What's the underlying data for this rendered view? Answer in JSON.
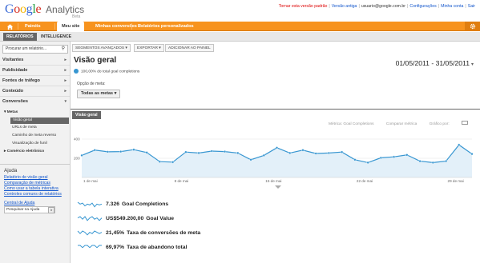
{
  "header": {
    "logo_google": "Google",
    "logo_analytics": "Analytics",
    "logo_beta": "Beta",
    "links": {
      "old_version": "Tornar esta versão padrão",
      "old_version_alt": "Versão antiga",
      "email": "usuario@google.com.br",
      "settings": "Configurações",
      "account": "Minha conta",
      "logout": "Sair"
    }
  },
  "nav": {
    "home_icon": "home-icon",
    "painel": "Painéis",
    "meu_site": "Meu site",
    "minhas_conversoes": "Minhas conversões",
    "relatorios": "Relatórios personalizados",
    "settings_icon": "gear-icon"
  },
  "subnav": {
    "relatorios": "RELATÓRIOS",
    "intelligence": "INTELLIGENCE"
  },
  "sidebar": {
    "search_placeholder": "Procurar um relatório...",
    "sections": [
      "Visitantes",
      "Publicidade",
      "Fontes de tráfego",
      "Conteúdo",
      "Conversões"
    ],
    "metas_label": "▾ Metas",
    "metas_items": [
      "Visão geral",
      "URLs de meta",
      "Caminho de meta reverso",
      "Visualização de funil"
    ],
    "ecommerce": "▸ Comércio eletrônico",
    "help": {
      "title": "Ajuda",
      "links": [
        "Relatório de visão geral",
        "Comparação de métricas",
        "Como usar a tabela interativa",
        "Controles comuns de relatórios"
      ],
      "center": "Central de Ajuda",
      "search_value": "Pesquisar na Ajuda",
      "go": "Ir"
    }
  },
  "toolbar": {
    "segments": "SEGMENTOS AVANÇADOS",
    "export": "EXPORTAR",
    "add_panel": "ADICIONAR AO PAINEL"
  },
  "main": {
    "title": "Visão geral",
    "pct_text": "100,00% do total goal completions",
    "date_range": "01/05/2011 - 31/05/2011",
    "goal_option_label": "Opção de meta:",
    "goal_select": "Todas as metas",
    "tab": "Visão geral",
    "graph_options": {
      "metric": "Métrica: Goal Completions",
      "compare": "Comparar métrica",
      "graph_by": "Gráfico por:"
    }
  },
  "chart_data": {
    "type": "area",
    "x_ticks": [
      "1 de mai",
      "8 de mai",
      "15 de mai",
      "22 de mai",
      "29 de mai"
    ],
    "y_ticks": [
      "400",
      "200"
    ],
    "ylim": [
      0,
      500
    ],
    "series": [
      {
        "values": [
          230,
          285,
          268,
          270,
          290,
          260,
          165,
          160,
          265,
          255,
          275,
          270,
          255,
          185,
          230,
          310,
          255,
          285,
          250,
          255,
          265,
          185,
          155,
          205,
          215,
          235,
          170,
          155,
          170,
          340,
          245
        ]
      }
    ]
  },
  "metrics": [
    {
      "value": "7.326",
      "label": "Goal Completions",
      "spark": [
        8,
        6,
        7,
        4,
        6,
        5,
        7,
        3,
        6,
        5,
        6
      ]
    },
    {
      "value": "US$549.200,00",
      "label": "Goal Value",
      "spark": [
        6,
        7,
        5,
        7,
        4,
        6,
        7,
        5,
        6,
        4,
        6
      ]
    },
    {
      "value": "21,45%",
      "label": "Taxa de conversões de meta",
      "spark": [
        7,
        5,
        7,
        6,
        4,
        6,
        5,
        7,
        6,
        5,
        6
      ]
    },
    {
      "value": "69,97%",
      "label": "Taxa de abandono total",
      "spark": [
        5,
        5,
        4,
        5,
        5,
        4,
        5,
        5,
        4,
        5,
        5
      ]
    }
  ],
  "colors": {
    "orange": "#f7931e",
    "line": "#3796d1",
    "area": "#e3f0f9"
  }
}
